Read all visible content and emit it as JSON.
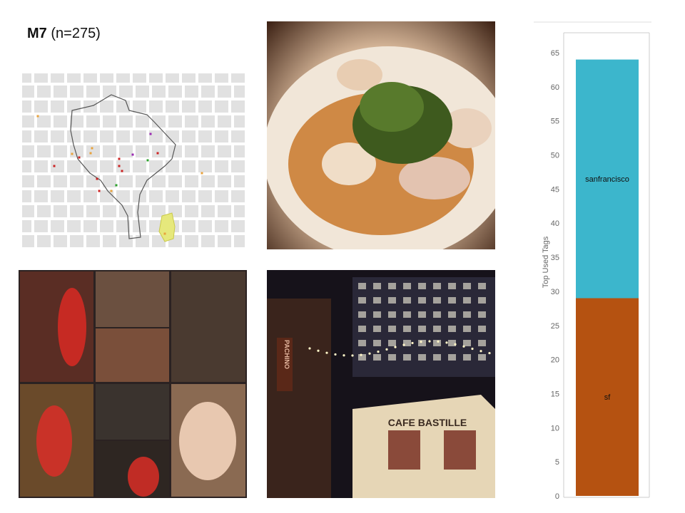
{
  "header": {
    "title_bold": "M7",
    "title_rest": " (n=275)"
  },
  "images": {
    "map": "map-of-downtown-san-francisco",
    "food": "photo-of-scallops-with-arugula",
    "collage": "photo-collage-of-friends-at-bar",
    "street": "photo-of-cafe-bastille-alley-at-night",
    "street_sign_text": "CAFE BASTILLE",
    "vertical_sign_text": "PACHINO"
  },
  "colors": {
    "teal": "#3cb6cc",
    "orange": "#b55211",
    "map_block": "#e1e1e1",
    "map_highlight": "#e6e87c"
  },
  "chart_data": {
    "type": "bar",
    "stacked": true,
    "categories": [
      ""
    ],
    "series": [
      {
        "name": "sf",
        "values": [
          29
        ],
        "color": "#b55211"
      },
      {
        "name": "sanfrancisco",
        "values": [
          35
        ],
        "color": "#3cb6cc"
      }
    ],
    "ylabel": "Top Used Tags",
    "xlabel": "",
    "ylim": [
      0,
      67
    ],
    "yticks": [
      0,
      5,
      10,
      15,
      20,
      25,
      30,
      35,
      40,
      45,
      50,
      55,
      60,
      65
    ],
    "grid": false,
    "legend": "none"
  }
}
